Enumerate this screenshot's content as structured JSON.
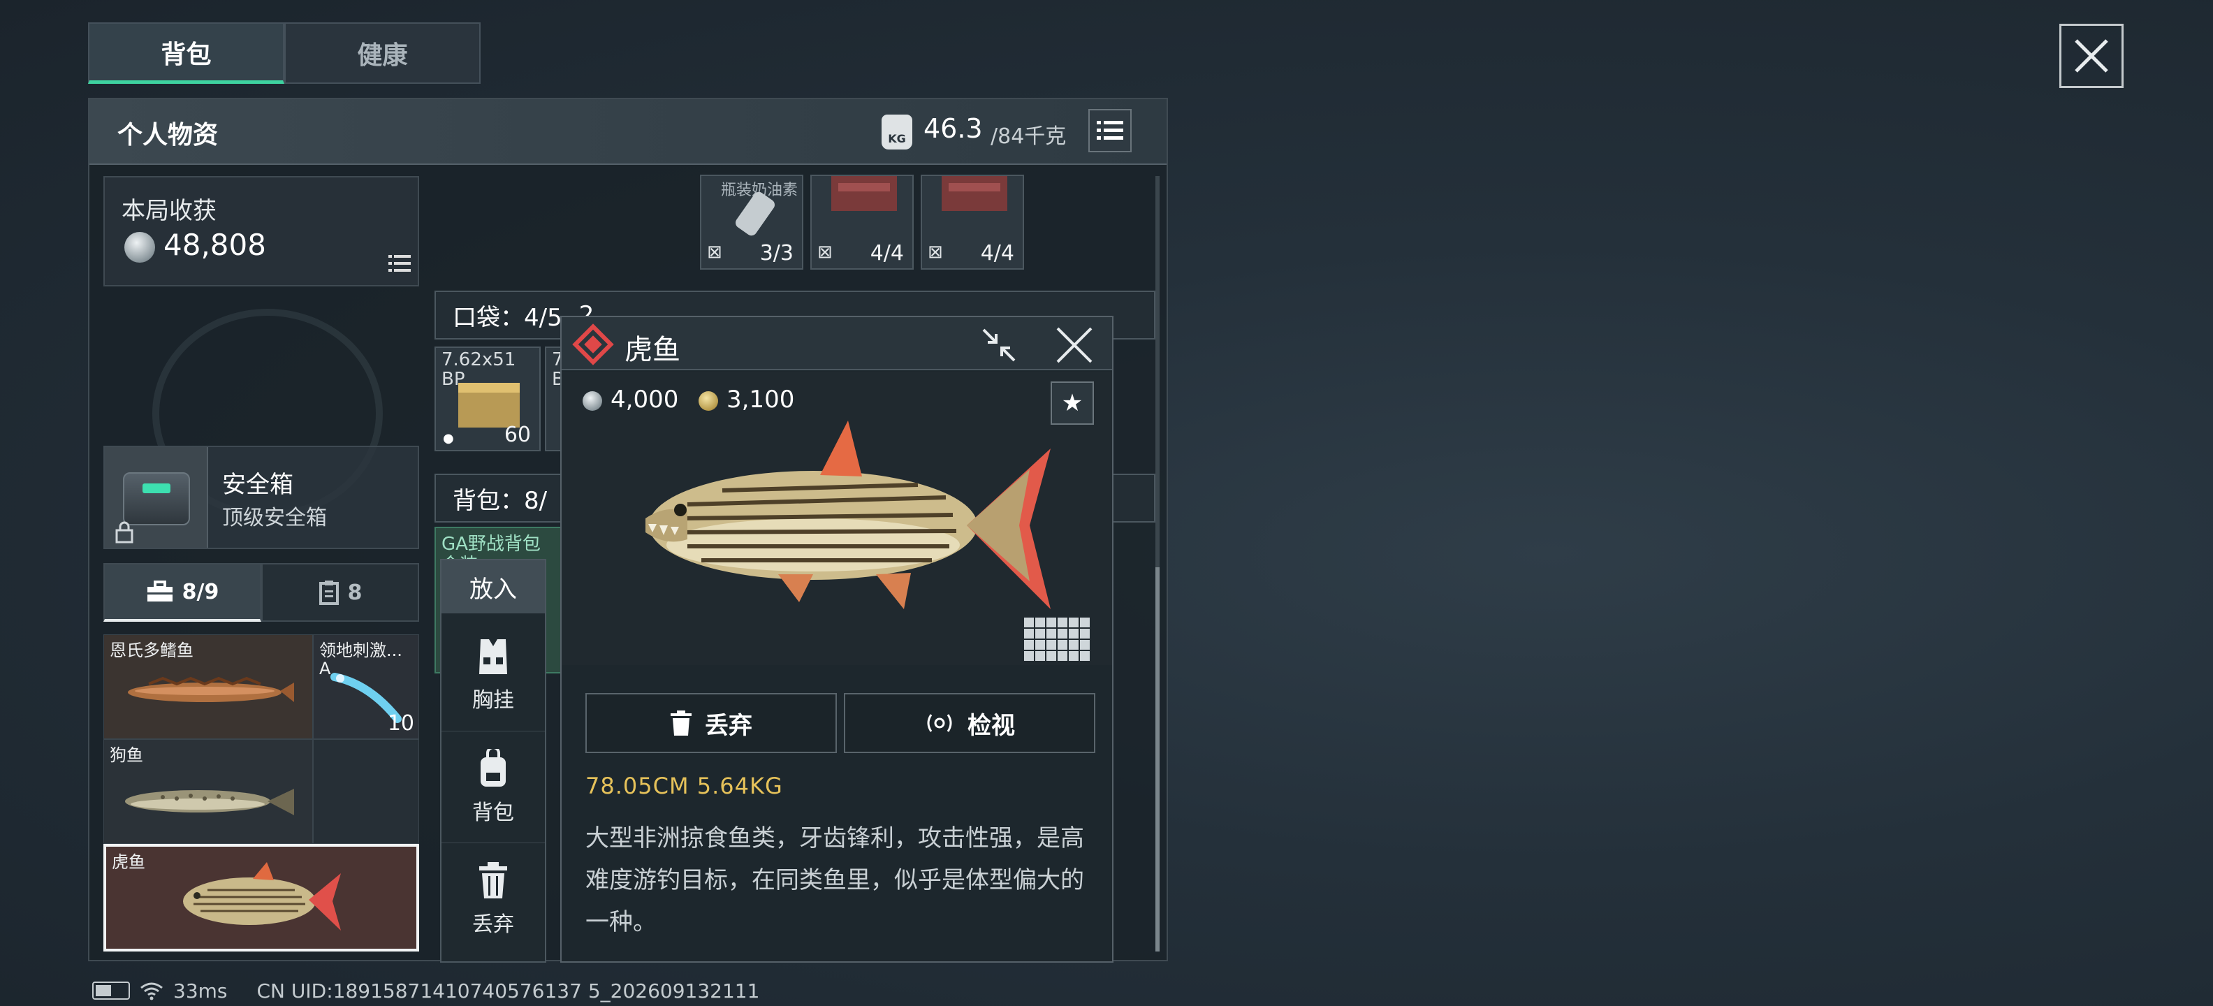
{
  "tabs": [
    {
      "label": "背包",
      "active": true
    },
    {
      "label": "健康",
      "active": false
    }
  ],
  "panel": {
    "title": "个人物资",
    "weight_current": "46.3",
    "weight_max": "/84千克",
    "weight_icon_text": "KG"
  },
  "harvest": {
    "label": "本局收获",
    "value": "48,808"
  },
  "safebox": {
    "name": "安全箱",
    "subtitle": "顶级安全箱"
  },
  "subtabs": [
    {
      "label": "8/9",
      "icon": "toolbox-icon",
      "active": true
    },
    {
      "label": "8",
      "icon": "clipboard-icon",
      "active": false
    }
  ],
  "fish_list": [
    {
      "name": "恩氏多鳍鱼",
      "count": ""
    },
    {
      "name": "领地刺激...",
      "sub": "A",
      "count": "10"
    },
    {
      "name": "狗鱼",
      "count": ""
    },
    {
      "name": "虎鱼",
      "count": "",
      "selected": true
    }
  ],
  "top_slots": [
    {
      "label": "瓶装奶油素",
      "count": "3/3"
    },
    {
      "label": "",
      "count": "4/4"
    },
    {
      "label": "",
      "count": "4/4"
    }
  ],
  "pocket": {
    "label": "口袋：4/5",
    "extra": "2"
  },
  "ammo_slots": [
    {
      "label": "7.62x51",
      "sub": "BP",
      "count": "60"
    },
    {
      "label": "7",
      "sub": "B",
      "count": ""
    }
  ],
  "backpack": {
    "label": "背包：8/",
    "item": "GA野战背包",
    "item_sub": "金装"
  },
  "actions": {
    "header": "放入",
    "items": [
      {
        "label": "胸挂",
        "icon": "vest-icon"
      },
      {
        "label": "背包",
        "icon": "backpack-icon"
      },
      {
        "label": "丢弃",
        "icon": "trash-icon"
      }
    ]
  },
  "detail": {
    "name": "虎鱼",
    "price_silver": "4,000",
    "price_gold": "3,100",
    "fav_symbol": "★",
    "discard_label": "丢弃",
    "inspect_label": "检视",
    "size": "78.05CM  5.64KG",
    "description": "大型非洲掠食鱼类，牙齿锋利，攻击性强，是高难度游钓目标，在同类鱼里，似乎是体型偏大的一种。"
  },
  "status": {
    "ping": "33ms",
    "uid": "CN UID:18915871410740576137 5_202609132111",
    "battery_level": 0.5
  },
  "colors": {
    "accent_green": "#3ed3a0",
    "rarity_red": "#e04848",
    "size_gold": "#e6c25a"
  }
}
